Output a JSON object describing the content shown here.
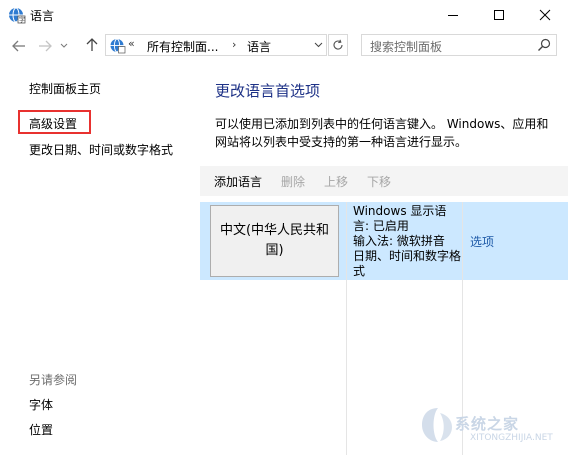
{
  "window": {
    "title": "语言"
  },
  "address": {
    "overflow": "«",
    "crumb1": "所有控制面...",
    "separator": "›",
    "crumb2": "语言"
  },
  "search": {
    "placeholder": "搜索控制面板"
  },
  "sidebar": {
    "items": [
      {
        "label": "控制面板主页"
      },
      {
        "label": "高级设置"
      },
      {
        "label": "更改日期、时间或数字格式"
      }
    ],
    "see_also": {
      "heading": "另请参阅",
      "items": [
        {
          "label": "字体"
        },
        {
          "label": "位置"
        }
      ]
    }
  },
  "main": {
    "title": "更改语言首选项",
    "description": "可以使用已添加到列表中的任何语言键入。 Windows、应用和网站将以列表中受支持的第一种语言进行显示。",
    "toolbar": {
      "add": "添加语言",
      "remove": "删除",
      "move_up": "上移",
      "move_down": "下移"
    },
    "languages": [
      {
        "name": "中文(中华人民共和国)",
        "info_line1": "Windows 显示语言: 已启用",
        "info_line2": "输入法: 微软拼音",
        "info_line3": "日期、时间和数字格式",
        "options": "选项"
      }
    ]
  },
  "watermark": {
    "text": "系统之家",
    "url": "XITONGZHIJIA.NET"
  },
  "colors": {
    "accent_title": "#1e3287",
    "link": "#1e5aa8",
    "selected_row": "#cce8ff",
    "highlight_box": "#e8312f"
  }
}
